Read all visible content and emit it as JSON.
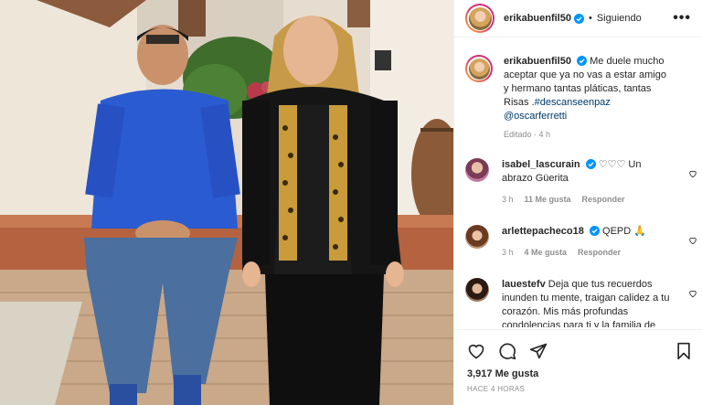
{
  "post": {
    "username": "erikabuenfil50",
    "follow_status": "Siguiendo",
    "dot": "•",
    "more": "•••",
    "caption": {
      "text_before": "Me duele mucho aceptar que ya no vas a estar amigo y hermano tantas pláticas, tantas Risas .",
      "hashtag": "#descanseenpaz",
      "mention": "@oscarferretti",
      "edited_label": "Editado",
      "time": "4 h"
    },
    "likes_count": "3,917",
    "likes_label": "Me gusta",
    "timestamp": "HACE 4 HORAS"
  },
  "comments": [
    {
      "username": "isabel_lascurain",
      "verified": true,
      "text": "♡♡♡ Un abrazo Güerita",
      "time": "3 h",
      "likes": "11 Me gusta",
      "reply": "Responder"
    },
    {
      "username": "arlettepacheco18",
      "verified": true,
      "text": "QEPD 🙏",
      "time": "3 h",
      "likes": "4 Me gusta",
      "reply": "Responder"
    },
    {
      "username": "lauestefv",
      "verified": false,
      "text": "Deja que tus recuerdos inunden tu mente, traigan calidez a tu corazón. Mis más profundas condolencias para ti y la familia de Óscar. Te mando un abrazo fuerte."
    }
  ],
  "icons": {
    "like": "heart-icon",
    "comment": "comment-icon",
    "share": "share-icon",
    "save": "bookmark-icon",
    "verified": "verified-badge-icon",
    "more": "more-options-icon"
  },
  "colors": {
    "verified": "#0095f6",
    "link": "#00376b",
    "muted": "#8e8e8e",
    "text": "#262626"
  }
}
